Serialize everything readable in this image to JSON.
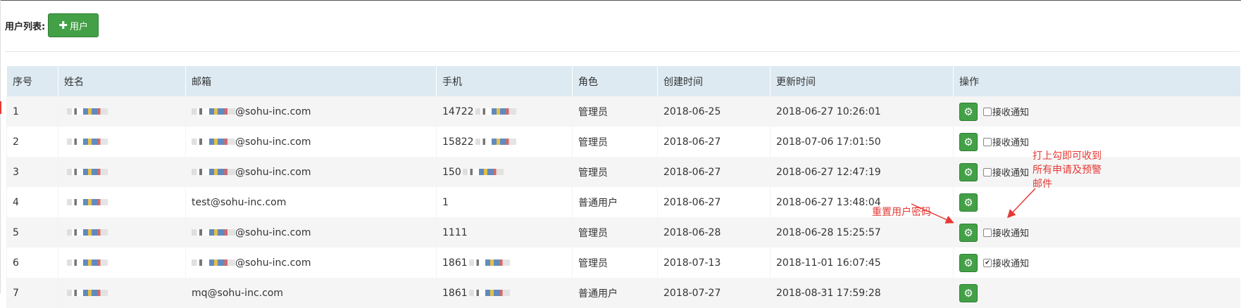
{
  "toolbar": {
    "label": "用户列表:",
    "add_icon": "plus-icon",
    "add_label": "用户"
  },
  "table": {
    "headers": [
      "序号",
      "姓名",
      "邮箱",
      "手机",
      "角色",
      "创建时间",
      "更新时间",
      "操作"
    ],
    "rows": [
      {
        "index": "1",
        "email_suffix": "@sohu-inc.com",
        "phone_prefix": "14722",
        "role": "管理员",
        "created": "2018-06-25",
        "updated": "2018-06-27 10:26:01",
        "notify": "接收通知",
        "notify_checked": false
      },
      {
        "index": "2",
        "email_suffix": "@sohu-inc.com",
        "phone_prefix": "15822",
        "role": "管理员",
        "created": "2018-06-27",
        "updated": "2018-07-06 17:01:50",
        "notify": "接收通知",
        "notify_checked": false
      },
      {
        "index": "3",
        "email_suffix": "@sohu-inc.com",
        "phone_prefix": "150",
        "role": "管理员",
        "created": "2018-06-27",
        "updated": "2018-06-27 12:47:19",
        "notify": "接收通知",
        "notify_checked": false
      },
      {
        "index": "4",
        "email_suffix": "test@sohu-inc.com",
        "phone_prefix": "1",
        "role": "普通用户",
        "created": "2018-06-27",
        "updated": "2018-06-27 13:48:04",
        "notify": "",
        "notify_checked": false
      },
      {
        "index": "5",
        "email_suffix": "@sohu-inc.com",
        "phone_prefix": "1111",
        "role": "管理员",
        "created": "2018-06-28",
        "updated": "2018-06-28 15:25:57",
        "notify": "接收通知",
        "notify_checked": false
      },
      {
        "index": "6",
        "email_suffix": "@sohu-inc.com",
        "phone_prefix": "1861",
        "role": "管理员",
        "created": "2018-07-13",
        "updated": "2018-11-01 16:07:45",
        "notify": "接收通知",
        "notify_checked": true
      },
      {
        "index": "7",
        "email_suffix": "mq@sohu-inc.com",
        "phone_prefix": "1861",
        "role": "普通用户",
        "created": "2018-07-27",
        "updated": "2018-08-31 17:59:28",
        "notify": "",
        "notify_checked": false
      }
    ]
  },
  "annotations": {
    "reset_password": "重置用户密码",
    "notify_hint_line1": "打上勾即可收到",
    "notify_hint_line2": "所有申请及预警",
    "notify_hint_line3": "邮件"
  },
  "colors": {
    "accent_green": "#43a047",
    "header_bg": "#ddeaf2",
    "annotation_red": "#e53935"
  },
  "icons": {
    "action": "gear-icon"
  }
}
